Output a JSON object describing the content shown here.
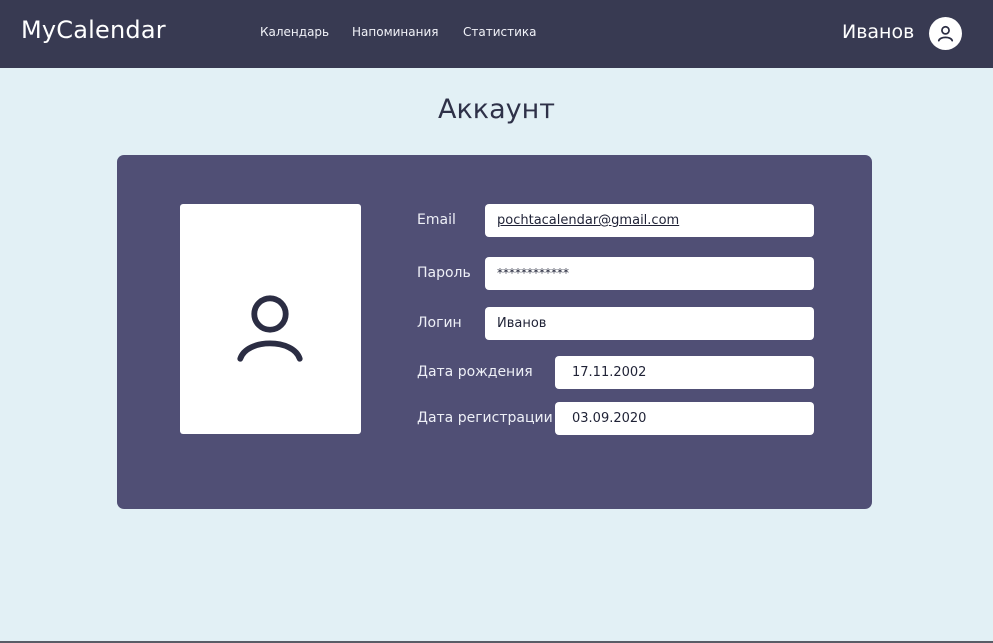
{
  "app": {
    "brand": "MyCalendar"
  },
  "nav": {
    "items": [
      "Календарь",
      "Напоминания",
      "Статистика"
    ]
  },
  "user": {
    "name": "Иванов",
    "icon": "user-icon"
  },
  "page": {
    "title": "Аккаунт"
  },
  "profile": {
    "photo_icon": "user-icon",
    "fields": {
      "email": {
        "label": "Email",
        "value": "pochtacalendar@gmail.com"
      },
      "password": {
        "label": "Пароль",
        "value": "************"
      },
      "login": {
        "label": "Логин",
        "value": "Иванов"
      },
      "birth": {
        "label": "Дата рождения",
        "value": "17.11.2002"
      },
      "registered": {
        "label": "Дата регистрации",
        "value": "03.09.2020"
      }
    }
  },
  "colors": {
    "header": "#383a52",
    "background": "#e2f0f5",
    "card": "#504f75",
    "title": "#2e3148"
  }
}
